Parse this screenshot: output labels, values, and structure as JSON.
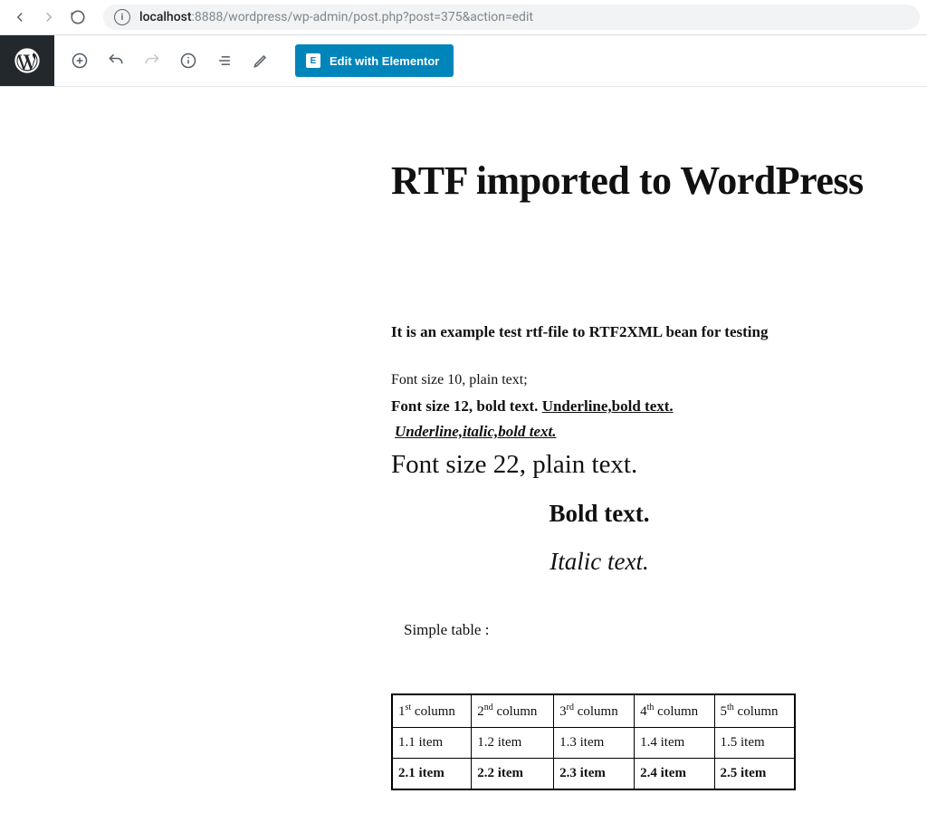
{
  "browser": {
    "url_host": "localhost",
    "url_port_path": ":8888/wordpress/wp-admin/post.php?post=375&action=edit"
  },
  "toolbar": {
    "elementor_label": "Edit with Elementor"
  },
  "post": {
    "title": "RTF imported to WordPress",
    "intro": "It is an example test rtf-file to RTF2XML bean for testing",
    "line10": "Font size 10, plain text;",
    "line12_prefix": "Font size 12, bold text. ",
    "line12_underline": "Underline,bold text.",
    "line_uib": "Underline,italic,bold text.",
    "line22": "Font size 22, plain text.",
    "line_bold": "Bold text.",
    "line_italic": "Italic text.",
    "line_simple": "Simple table :",
    "table": {
      "headers": [
        {
          "n": "1",
          "sup": "st",
          "suffix": " column"
        },
        {
          "n": "2",
          "sup": "nd",
          "suffix": " column"
        },
        {
          "n": "3",
          "sup": "rd",
          "suffix": " column"
        },
        {
          "n": "4",
          "sup": "th",
          "suffix": " column"
        },
        {
          "n": "5",
          "sup": "th",
          "suffix": " column"
        }
      ],
      "rows": [
        [
          "1.1 item",
          "1.2 item",
          "1.3 item",
          "1.4 item",
          "1.5 item"
        ],
        [
          "2.1 item",
          "2.2 item",
          "2.3 item",
          "2.4 item",
          "2.5 item"
        ]
      ]
    }
  }
}
